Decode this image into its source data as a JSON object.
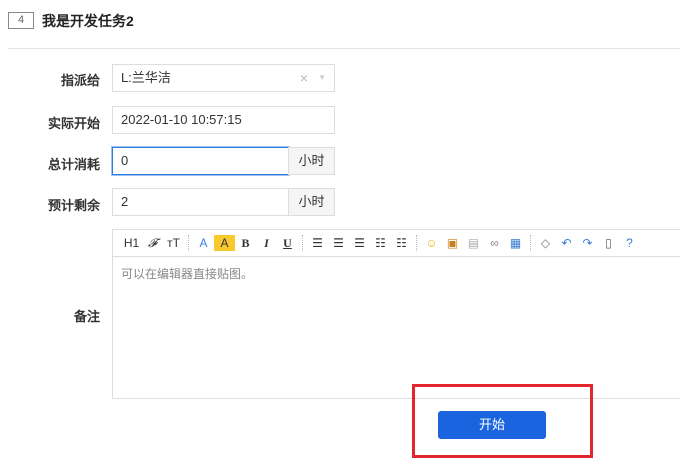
{
  "task": {
    "id": "4",
    "title": "我是开发任务2"
  },
  "form": {
    "assign_label": "指派给",
    "assign_value": "L:兰华洁",
    "start_label": "实际开始",
    "start_value": "2022-01-10 10:57:15",
    "consumed_label": "总计消耗",
    "consumed_value": "0",
    "consumed_unit": "小时",
    "left_label": "预计剩余",
    "left_value": "2",
    "left_unit": "小时",
    "comment_label": "备注",
    "comment_placeholder": "可以在编辑器直接贴图。"
  },
  "toolbar": {
    "heading": "H1",
    "font": "𝓕",
    "size": "тT",
    "fontcolor": "A",
    "bgcolor": "A",
    "bold": "B",
    "italic": "I",
    "underline": "U"
  },
  "submit_label": "开始",
  "colors": {
    "primary": "#1b64e0",
    "highlight": "#e3262d"
  }
}
